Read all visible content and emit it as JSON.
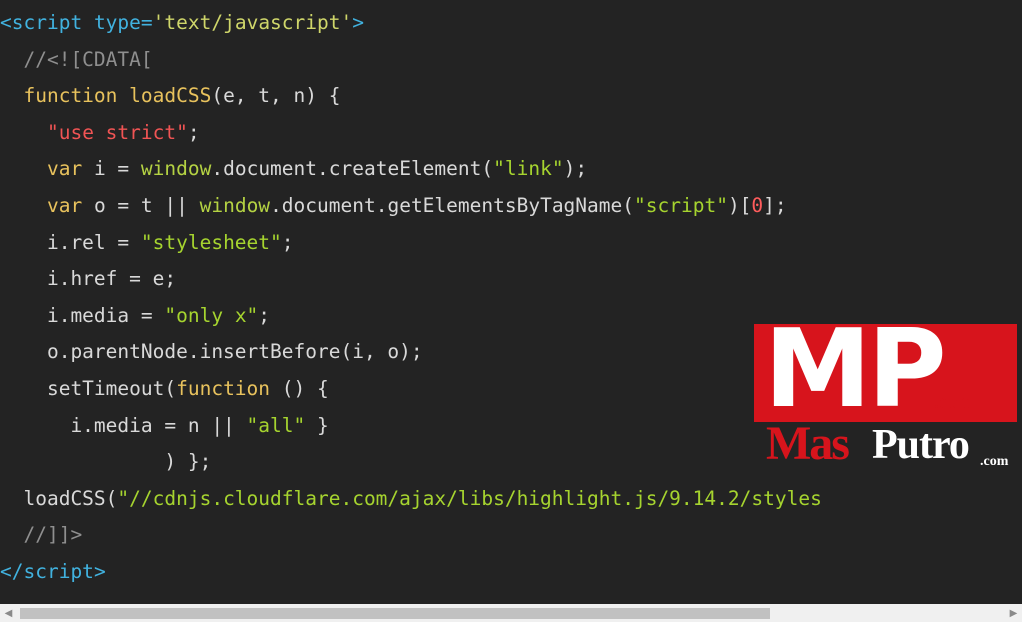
{
  "code": {
    "l1": {
      "open": "<",
      "tag": "script",
      "attr": " type=",
      "val": "'text/javascript'",
      "close": ">"
    },
    "l2": "  //<![CDATA[",
    "l3": {
      "indent": "  ",
      "kw": "function",
      "name": " loadCSS",
      "rest": "(e, t, n) {"
    },
    "l4": {
      "indent": "    ",
      "str": "\"use strict\"",
      "semi": ";"
    },
    "l5": {
      "indent": "    ",
      "kw": "var",
      "a": " i = ",
      "obj": "window",
      "b": ".document.createElement(",
      "str": "\"link\"",
      "c": ");"
    },
    "l6": {
      "indent": "    ",
      "kw": "var",
      "a": " o = t || ",
      "obj": "window",
      "b": ".document.getElementsByTagName(",
      "str": "\"script\"",
      "c": ")[",
      "num": "0",
      "d": "];"
    },
    "l7": {
      "a": "    i.rel = ",
      "str": "\"stylesheet\"",
      "c": ";"
    },
    "l8": "    i.href = e;",
    "l9": {
      "a": "    i.media = ",
      "str": "\"only x\"",
      "c": ";"
    },
    "l10": "    o.parentNode.insertBefore(i, o);",
    "l11": {
      "a": "    setTimeout(",
      "kw": "function",
      "b": " () {"
    },
    "l12": {
      "a": "      i.media = n || ",
      "str": "\"all\"",
      "b": " }"
    },
    "l13": "              ) };",
    "l14": {
      "a": "  loadCSS(",
      "str": "\"//cdnjs.cloudflare.com/ajax/libs/highlight.js/9.14.2/styles"
    },
    "l15": "  //]]>",
    "l16": {
      "open": "</",
      "tag": "script",
      "close": ">"
    }
  },
  "watermark": {
    "mp": "MP",
    "com": ".com",
    "name_red": "Mas",
    "name_white": "Putro",
    "com2": ".com"
  },
  "scrollbar": {
    "left_arrow": "◀",
    "right_arrow": "▶"
  }
}
